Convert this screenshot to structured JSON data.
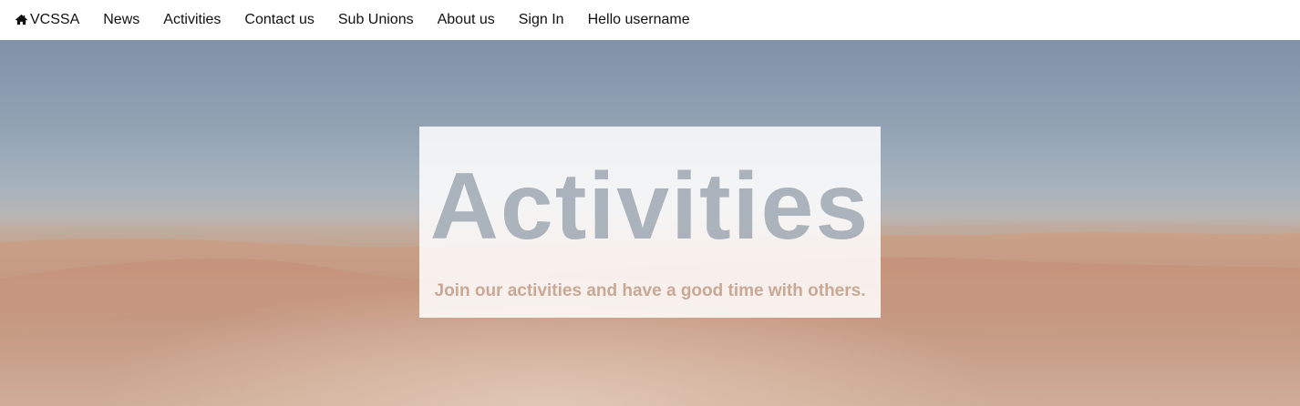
{
  "navbar": {
    "brand_icon": "home-icon",
    "brand_label": "VCSSA",
    "links": [
      {
        "label": "News"
      },
      {
        "label": "Activities"
      },
      {
        "label": "Contact us"
      },
      {
        "label": "Sub Unions"
      },
      {
        "label": "About us"
      },
      {
        "label": "Sign In"
      },
      {
        "label": "Hello username"
      }
    ]
  },
  "hero": {
    "title": "Activities",
    "subtitle": "Join our activities and have a good time with others.",
    "background": "desert-dunes-photo"
  },
  "colors": {
    "sky": "#8a9cb0",
    "sand": "#c49378",
    "title_text": "#969fac",
    "subtitle_text": "#c9a996"
  }
}
